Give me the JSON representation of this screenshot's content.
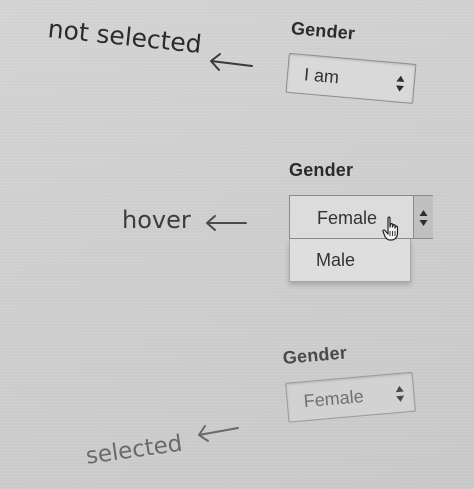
{
  "annotations": {
    "not_selected": "not selected",
    "hover": "hover",
    "selected": "selected"
  },
  "states": [
    {
      "label": "Gender",
      "select_value": "I am",
      "icon": "up-down-arrows-icon"
    },
    {
      "label": "Gender",
      "highlighted_option": "Female",
      "options": [
        "Female",
        "Male"
      ],
      "icon": "up-down-arrows-icon",
      "cursor": "pointer-hand-cursor"
    },
    {
      "label": "Gender",
      "select_value": "Female",
      "icon": "up-down-arrows-icon"
    }
  ],
  "colors": {
    "background": "#cfcfcf",
    "text_dark": "#2b2b2b",
    "text_muted": "#707070",
    "border": "#8d8d8d"
  }
}
